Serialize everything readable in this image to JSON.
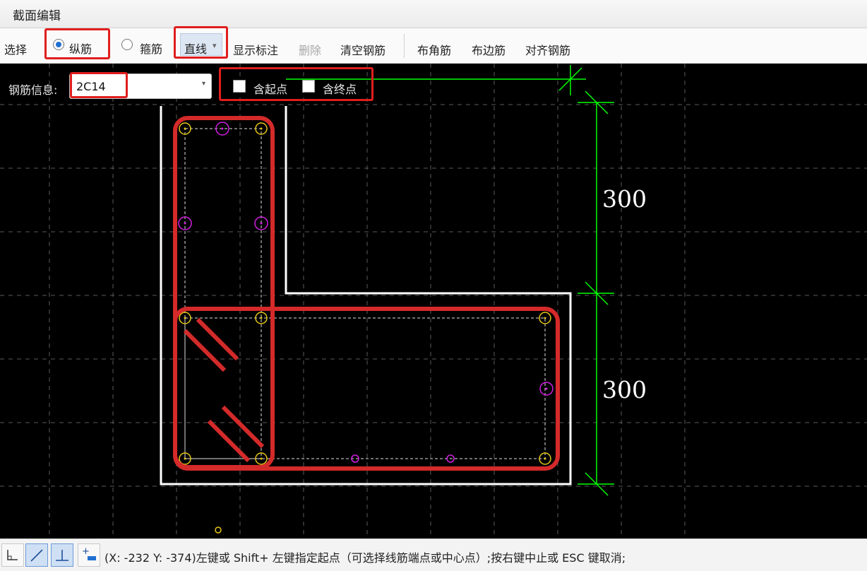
{
  "window": {
    "title": "截面编辑"
  },
  "toolbar": {
    "select_label": "选择",
    "longitudinal_label": "纵筋",
    "stirrup_label": "箍筋",
    "line_type_value": "直线",
    "line_type_arrow": "▾",
    "show_dim_label": "显示标注",
    "delete_label": "删除",
    "clear_label": "清空钢筋",
    "corner_label": "布角筋",
    "edge_label": "布边筋",
    "align_label": "对齐钢筋",
    "selected_mode": "纵筋"
  },
  "rebar_info": {
    "label": "钢筋信息:",
    "value": "2C14",
    "dropdown_arrow": "▾",
    "include_start_label": "含起点",
    "include_start_checked": false,
    "include_end_label": "含终点",
    "include_end_checked": false
  },
  "drawing": {
    "dimension_upper": "300",
    "dimension_lower": "300",
    "colors": {
      "background": "#000000",
      "section_outline": "#ffffff",
      "dimension": "#00ff00",
      "corner_rebar": "#e6c619",
      "edge_rebar": "#d21ee0",
      "annotation": "#d42a2a",
      "grid": "#5a5a5a"
    }
  },
  "statusbar": {
    "tool_icons": [
      "corner-ortho-icon",
      "line-icon",
      "perpendicular-icon",
      "add-point-icon"
    ],
    "message": "(X: -232 Y: -374)左键或 Shift+ 左键指定起点（可选择线筋端点或中心点）;按右键中止或 ESC 键取消;"
  }
}
